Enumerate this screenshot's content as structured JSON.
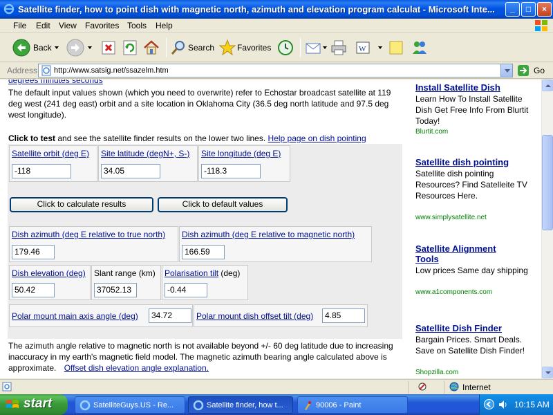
{
  "window": {
    "title": "Satellite finder, how to point dish with magnetic north, azimuth and elevation program calculat - Microsoft Inte...",
    "buttons": {
      "minimize": "_",
      "maximize": "□",
      "close": "×"
    }
  },
  "menu": {
    "items": [
      "File",
      "Edit",
      "View",
      "Favorites",
      "Tools",
      "Help"
    ]
  },
  "toolbar": {
    "back": "Back",
    "search": "Search",
    "favorites": "Favorites"
  },
  "address": {
    "label": "Address",
    "url": "http://www.satsig.net/ssazelm.htm",
    "go": "Go"
  },
  "page": {
    "cut_link": "degrees minutes seconds",
    "intro": "The default input values shown (which you need to overwrite) refer to Echostar broadcast satellite at 119 deg west (241 deg east) orbit and a site location in Oklahoma City (36.5 deg north latitude and 97.5 deg west longitude).",
    "click_bold": "Click to test",
    "click_rest": " and see the satellite finder results on the lower two lines.",
    "help_link": "Help page on dish pointing",
    "labels": {
      "sat_orbit": "Satellite orbit (deg E)",
      "site_lat": "Site latitude (degN+, S-)",
      "site_lon": "Site longitude (deg E)",
      "az_true": "Dish azimuth (deg E relative to true north)",
      "az_mag": "Dish azimuth (deg E relative to magnetic north)",
      "elevation": "Dish elevation (deg)",
      "slant": "Slant range (km)",
      "pol_tilt": "Polarisation tilt",
      "pol_tilt_unit": " (deg)",
      "polar_main": "Polar mount main axis angle (deg)",
      "polar_offset": "Polar mount dish offset tilt (deg)"
    },
    "values": {
      "sat_orbit": "-118",
      "site_lat": "34.05",
      "site_lon": "-118.3",
      "az_true": "179.46",
      "az_mag": "166.59",
      "elevation": "50.42",
      "slant": "37052.13",
      "pol_tilt": "-0.44",
      "polar_main": "34.72",
      "polar_offset": "4.85"
    },
    "buttons": {
      "calculate": "Click to calculate results",
      "defaults": "Click to default values"
    },
    "note": "The azimuth angle relative to magnetic north is not available beyond +/- 60 deg latitude due to increasing inaccuracy in my earth's magnetic field model.   The magnetic azimuth bearing angle calculated above is approximate.",
    "note_link": "Offset dish elevation angle explanation."
  },
  "ads": [
    {
      "title": "Install Satellite Dish",
      "body": "Learn How To Install Satellite Dish Get Free Info From Blurtit Today!",
      "url": "Blurtit.com"
    },
    {
      "title": "Satellite dish pointing",
      "body": "Satellite dish pointing Resources? Find Satelleite TV Resources Here.",
      "url": "www.simplysatellite.net"
    },
    {
      "title_line1": "Satellite Alignment",
      "title_line2": "Tools",
      "body": "Low prices Same day shipping",
      "url": "www.a1components.com"
    },
    {
      "title": "Satellite Dish Finder",
      "body": "Bargain Prices. Smart Deals. Save on Satellite Dish Finder!",
      "url": "Shopzilla.com"
    }
  ],
  "status": {
    "zone": "Internet"
  },
  "taskbar": {
    "start": "start",
    "tasks": [
      "SatelliteGuys.US - Re...",
      "Satellite finder, how t...",
      "90006 - Paint"
    ],
    "clock": "10:15 AM"
  },
  "colors": {
    "link": "#001090",
    "ad_url": "#008000",
    "titlebar": "#0054e3",
    "taskbar": "#2157d7",
    "start": "#3a9b3a"
  }
}
